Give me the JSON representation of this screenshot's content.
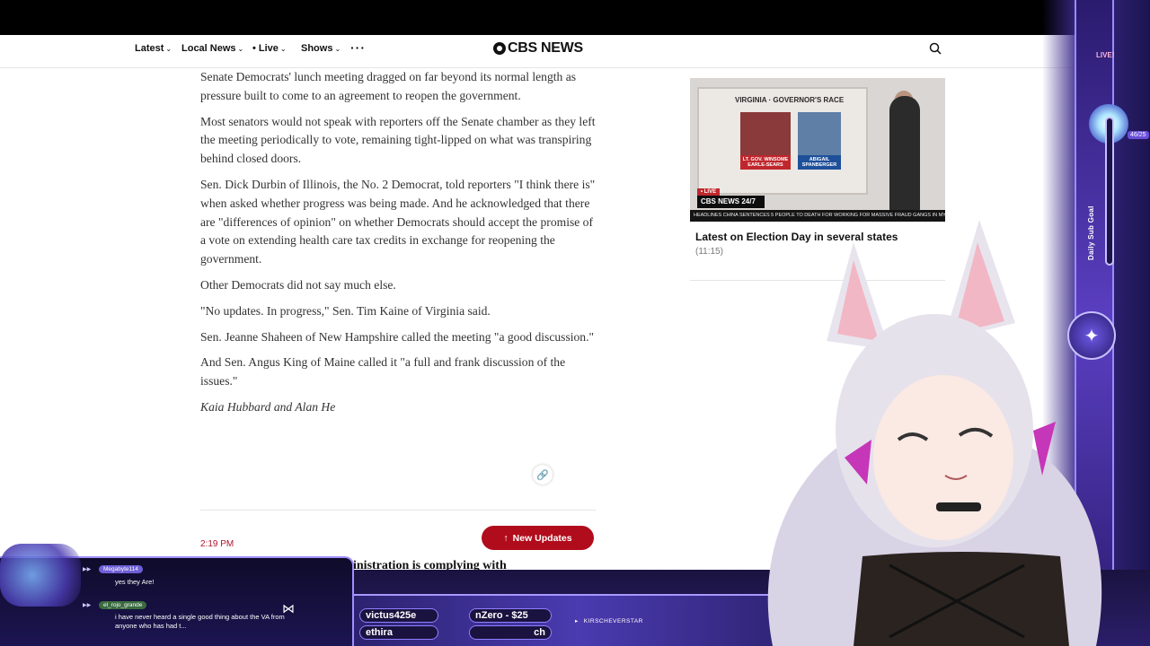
{
  "nav": {
    "items": [
      {
        "label": "Latest"
      },
      {
        "label": "Local News"
      },
      {
        "label": "• Live"
      },
      {
        "label": "Shows"
      }
    ],
    "more_icon": "more-dots-icon",
    "logo": "CBS NEWS",
    "search_icon": "search-icon"
  },
  "article": {
    "paragraphs": [
      "Senate Democrats' lunch meeting dragged on far beyond its normal length as pressure built to come to an agreement to reopen the government.",
      "Most senators would not speak with reporters off the Senate chamber as they left the meeting periodically to vote, remaining tight-lipped on what was transpiring behind closed doors.",
      "Sen. Dick Durbin of Illinois, the No. 2 Democrat, told reporters \"I think there is\" when asked whether progress was being made. And he acknowledged that there are \"differences of opinion\" on whether Democrats should accept the promise of a vote on extending health care tax credits in exchange for reopening the government.",
      "Other Democrats did not say much else.",
      "\"No updates. In progress,\" Sen. Tim Kaine of Virginia said.",
      "Sen. Jeanne Shaheen of New Hampshire called the meeting \"a good discussion.\"",
      "And Sen. Angus King of Maine called it \"a full and frank discussion of the issues.\""
    ],
    "byline": "Kaia Hubbard and Alan He",
    "link_icon": "link-icon",
    "time": "2:19 PM",
    "new_updates_label": "New Updates",
    "next_headline": "inistration is complying with"
  },
  "video": {
    "board_title": "VIRGINIA · GOVERNOR'S RACE",
    "candidate1": "LT. GOV. WINSOME EARLE-SEARS",
    "candidate2": "ABIGAIL SPANBERGER",
    "live": "• LIVE",
    "brand": "CBS NEWS 24/7",
    "ticker": "HEADLINES  CHINA SENTENCES 5 PEOPLE TO DEATH FOR WORKING FOR MASSIVE FRAUD GANGS IN MYANMAR",
    "title": "Latest on Election Day in several states",
    "duration": "(11:15)"
  },
  "overlay": {
    "live_badge": "LIVE!",
    "goal_label": "Daily Sub Goal",
    "goal_count": "46/25",
    "goal_progress": 1.0,
    "ticker1": "victus425e",
    "ticker2": "nZero - $25",
    "ticker3": "ethira",
    "ticker4": "ch",
    "social": "KIRSCHEVERSTAR"
  },
  "chat": {
    "messages": [
      {
        "user": "Megabyte114",
        "text": "yes they Are!"
      },
      {
        "user": "el_rojo_grande",
        "text": "i have never heard a single good thing about the VA from anyone who has had t..."
      }
    ]
  },
  "colors": {
    "accent_red": "#b10c1c",
    "overlay_purple": "#3b2a8a"
  }
}
